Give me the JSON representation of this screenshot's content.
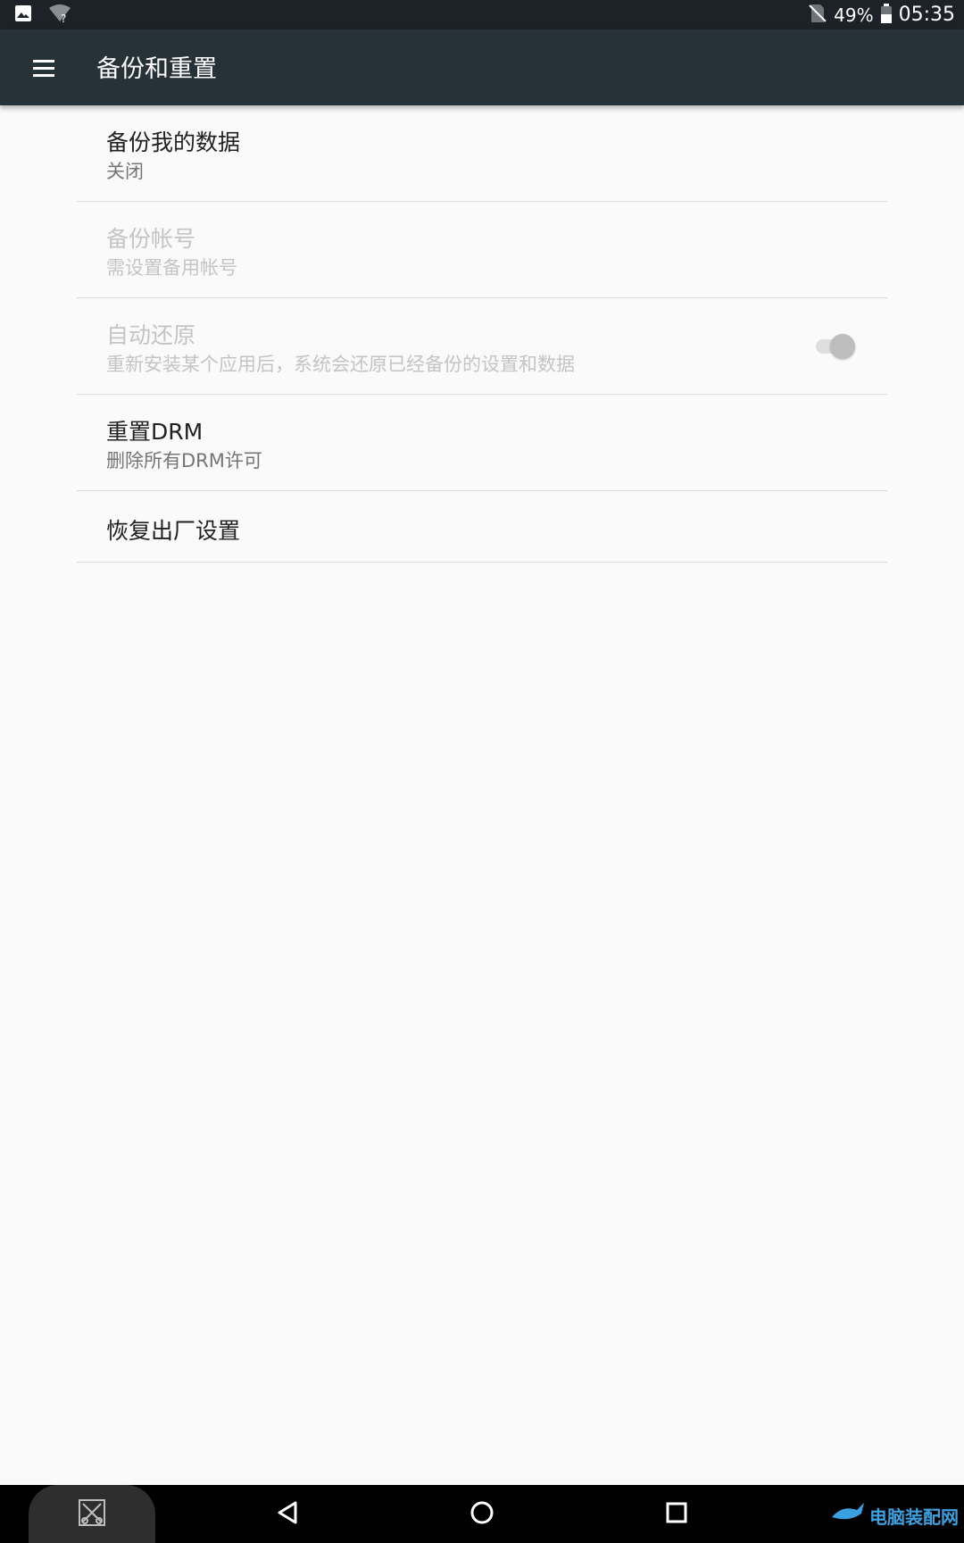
{
  "status_bar": {
    "battery_percent": "49%",
    "time": "05:35",
    "icons": [
      "image-icon",
      "wifi-unknown-icon",
      "no-sim-icon",
      "battery-icon"
    ]
  },
  "app_bar": {
    "title": "备份和重置",
    "menu_icon": "menu-icon"
  },
  "settings": {
    "items": [
      {
        "title": "备份我的数据",
        "summary": "关闭",
        "enabled": true
      },
      {
        "title": "备份帐号",
        "summary": "需设置备用帐号",
        "enabled": false
      },
      {
        "title": "自动还原",
        "summary": "重新安装某个应用后，系统会还原已经备份的设置和数据",
        "enabled": false,
        "toggle": "off"
      },
      {
        "title": "重置DRM",
        "summary": "删除所有DRM许可",
        "enabled": true
      },
      {
        "title": "恢复出厂设置",
        "enabled": true
      }
    ]
  },
  "nav_bar": {
    "buttons": [
      "screenshot-icon",
      "back-icon",
      "home-icon",
      "recents-icon"
    ],
    "watermark": "电脑装配网"
  },
  "colors": {
    "status_bar": "#1c2227",
    "app_bar": "#263238",
    "background": "#fafafa",
    "disabled_text": "#c4c4c4"
  }
}
